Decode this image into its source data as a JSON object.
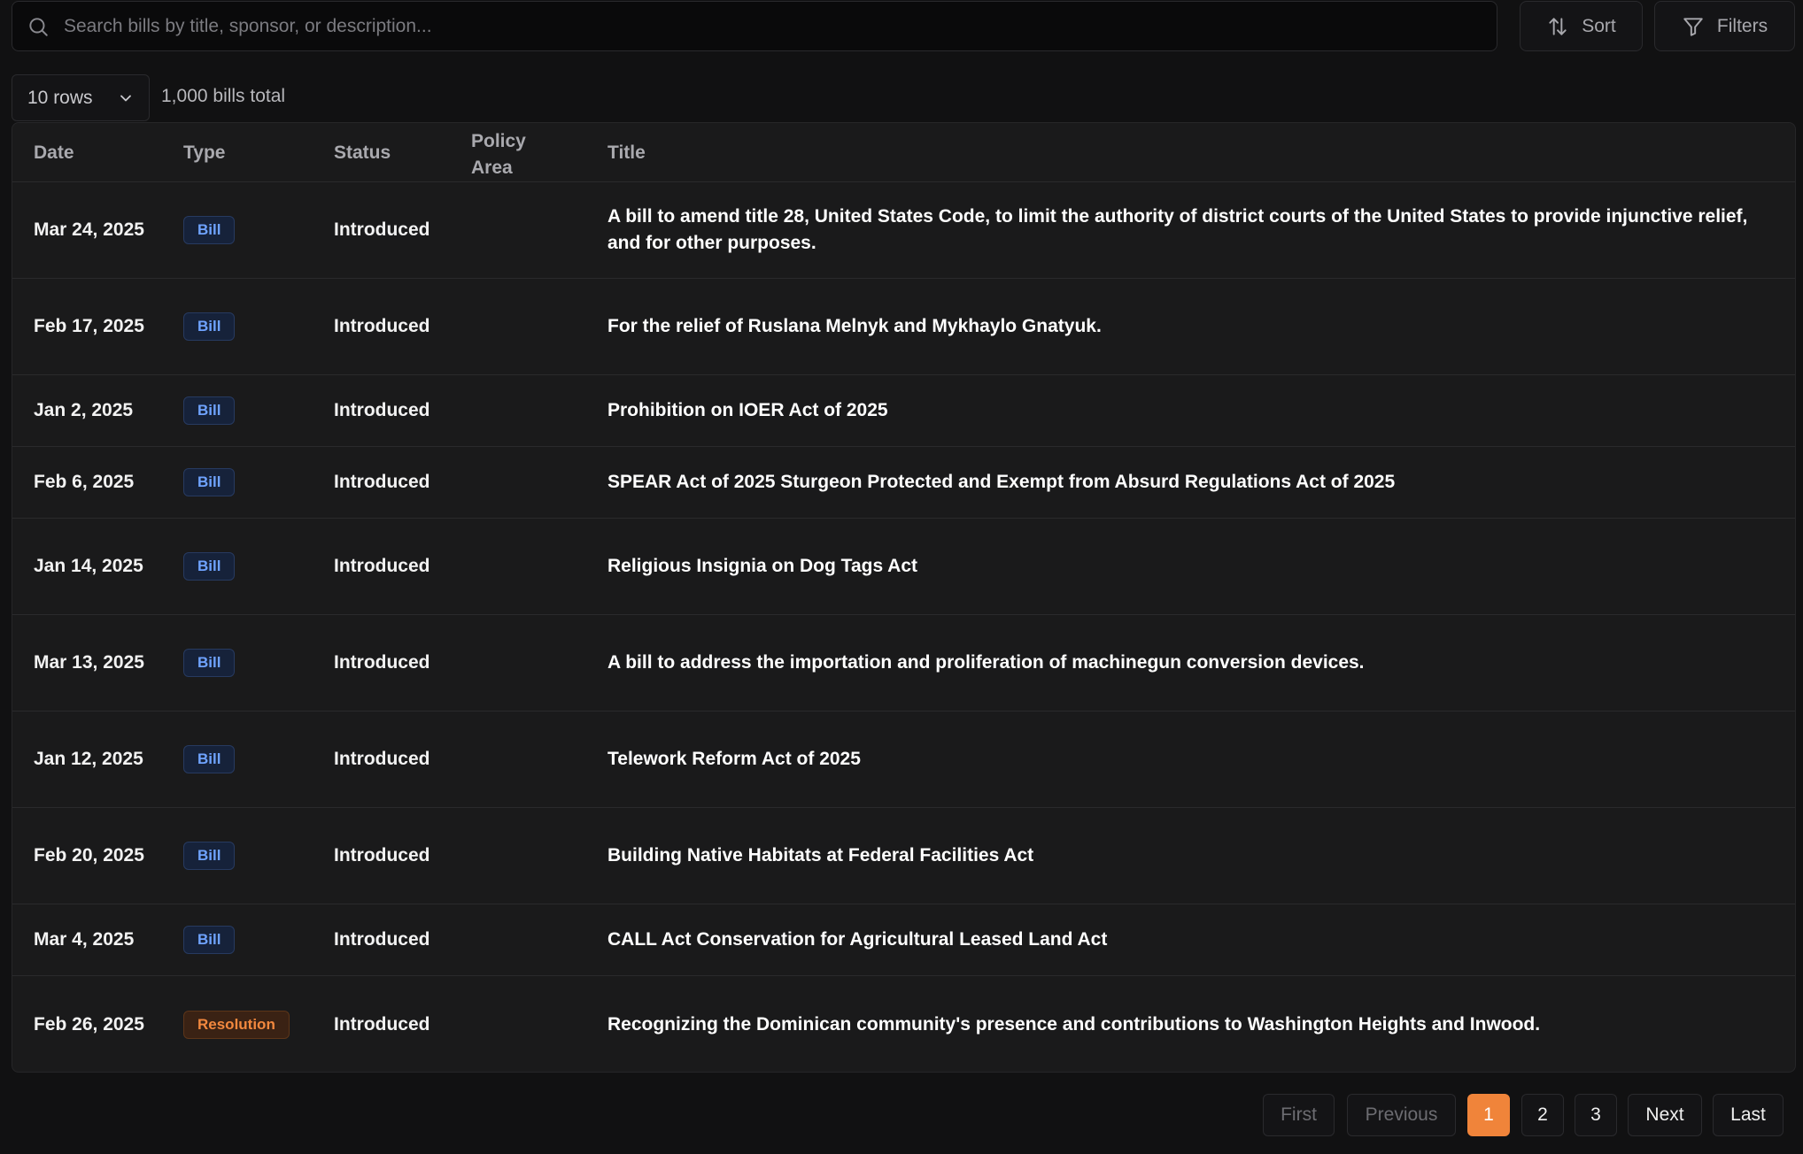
{
  "search": {
    "placeholder": "Search bills by title, sponsor, or description..."
  },
  "toolbar": {
    "sort_label": "Sort",
    "filters_label": "Filters"
  },
  "rows_select": {
    "value": "10 rows"
  },
  "total_label": "1,000 bills total",
  "table": {
    "headers": {
      "date": "Date",
      "type": "Type",
      "status": "Status",
      "policy": "Policy Area",
      "title": "Title"
    },
    "rows": [
      {
        "date": "Mar 24, 2025",
        "type": "Bill",
        "status": "Introduced",
        "policy": "",
        "title": "A bill to amend title 28, United States Code, to limit the authority of district courts of the United States to provide injunctive relief, and for other purposes."
      },
      {
        "date": "Feb 17, 2025",
        "type": "Bill",
        "status": "Introduced",
        "policy": "",
        "title": "For the relief of Ruslana Melnyk and Mykhaylo Gnatyuk."
      },
      {
        "date": "Jan 2, 2025",
        "type": "Bill",
        "status": "Introduced",
        "policy": "",
        "title": "Prohibition on IOER Act of 2025"
      },
      {
        "date": "Feb 6, 2025",
        "type": "Bill",
        "status": "Introduced",
        "policy": "",
        "title": "SPEAR Act of 2025 Sturgeon Protected and Exempt from Absurd Regulations Act of 2025"
      },
      {
        "date": "Jan 14, 2025",
        "type": "Bill",
        "status": "Introduced",
        "policy": "",
        "title": "Religious Insignia on Dog Tags Act"
      },
      {
        "date": "Mar 13, 2025",
        "type": "Bill",
        "status": "Introduced",
        "policy": "",
        "title": "A bill to address the importation and proliferation of machinegun conversion devices."
      },
      {
        "date": "Jan 12, 2025",
        "type": "Bill",
        "status": "Introduced",
        "policy": "",
        "title": "Telework Reform Act of 2025"
      },
      {
        "date": "Feb 20, 2025",
        "type": "Bill",
        "status": "Introduced",
        "policy": "",
        "title": "Building Native Habitats at Federal Facilities Act"
      },
      {
        "date": "Mar 4, 2025",
        "type": "Bill",
        "status": "Introduced",
        "policy": "",
        "title": "CALL Act Conservation for Agricultural Leased Land Act"
      },
      {
        "date": "Feb 26, 2025",
        "type": "Resolution",
        "status": "Introduced",
        "policy": "",
        "title": "Recognizing the Dominican community's presence and contributions to Washington Heights and Inwood."
      }
    ]
  },
  "pagination": {
    "first": "First",
    "previous": "Previous",
    "pages": [
      "1",
      "2",
      "3"
    ],
    "current": "1",
    "next": "Next",
    "last": "Last"
  },
  "colors": {
    "accent": "#f0843a",
    "bill_badge": "#6fa3ff",
    "resolution_badge": "#f2883e"
  },
  "icons": {
    "search": "search-icon",
    "sort": "sort-arrows-icon",
    "filter": "filter-icon",
    "chevron": "chevron-down-icon"
  }
}
